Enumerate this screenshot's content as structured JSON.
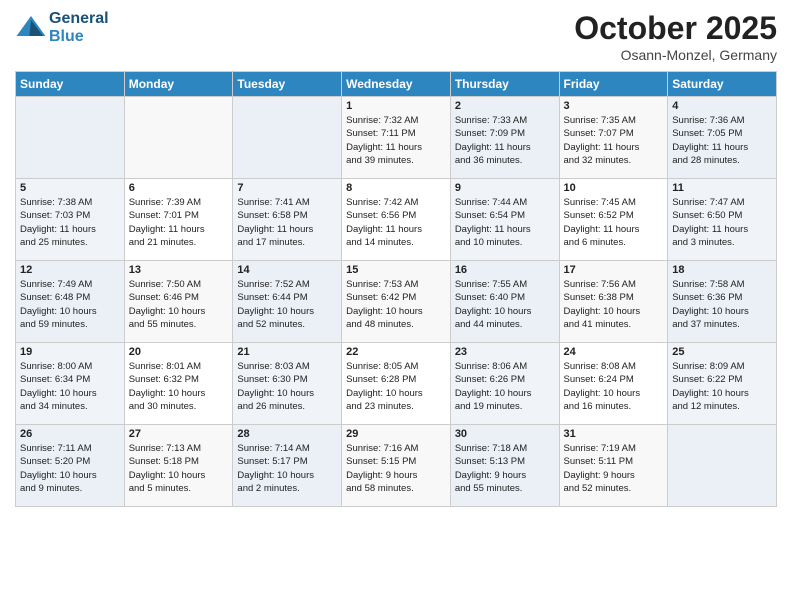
{
  "header": {
    "logo_line1": "General",
    "logo_line2": "Blue",
    "month": "October 2025",
    "location": "Osann-Monzel, Germany"
  },
  "days_of_week": [
    "Sunday",
    "Monday",
    "Tuesday",
    "Wednesday",
    "Thursday",
    "Friday",
    "Saturday"
  ],
  "weeks": [
    [
      {
        "day": "",
        "info": ""
      },
      {
        "day": "",
        "info": ""
      },
      {
        "day": "",
        "info": ""
      },
      {
        "day": "1",
        "info": "Sunrise: 7:32 AM\nSunset: 7:11 PM\nDaylight: 11 hours\nand 39 minutes."
      },
      {
        "day": "2",
        "info": "Sunrise: 7:33 AM\nSunset: 7:09 PM\nDaylight: 11 hours\nand 36 minutes."
      },
      {
        "day": "3",
        "info": "Sunrise: 7:35 AM\nSunset: 7:07 PM\nDaylight: 11 hours\nand 32 minutes."
      },
      {
        "day": "4",
        "info": "Sunrise: 7:36 AM\nSunset: 7:05 PM\nDaylight: 11 hours\nand 28 minutes."
      }
    ],
    [
      {
        "day": "5",
        "info": "Sunrise: 7:38 AM\nSunset: 7:03 PM\nDaylight: 11 hours\nand 25 minutes."
      },
      {
        "day": "6",
        "info": "Sunrise: 7:39 AM\nSunset: 7:01 PM\nDaylight: 11 hours\nand 21 minutes."
      },
      {
        "day": "7",
        "info": "Sunrise: 7:41 AM\nSunset: 6:58 PM\nDaylight: 11 hours\nand 17 minutes."
      },
      {
        "day": "8",
        "info": "Sunrise: 7:42 AM\nSunset: 6:56 PM\nDaylight: 11 hours\nand 14 minutes."
      },
      {
        "day": "9",
        "info": "Sunrise: 7:44 AM\nSunset: 6:54 PM\nDaylight: 11 hours\nand 10 minutes."
      },
      {
        "day": "10",
        "info": "Sunrise: 7:45 AM\nSunset: 6:52 PM\nDaylight: 11 hours\nand 6 minutes."
      },
      {
        "day": "11",
        "info": "Sunrise: 7:47 AM\nSunset: 6:50 PM\nDaylight: 11 hours\nand 3 minutes."
      }
    ],
    [
      {
        "day": "12",
        "info": "Sunrise: 7:49 AM\nSunset: 6:48 PM\nDaylight: 10 hours\nand 59 minutes."
      },
      {
        "day": "13",
        "info": "Sunrise: 7:50 AM\nSunset: 6:46 PM\nDaylight: 10 hours\nand 55 minutes."
      },
      {
        "day": "14",
        "info": "Sunrise: 7:52 AM\nSunset: 6:44 PM\nDaylight: 10 hours\nand 52 minutes."
      },
      {
        "day": "15",
        "info": "Sunrise: 7:53 AM\nSunset: 6:42 PM\nDaylight: 10 hours\nand 48 minutes."
      },
      {
        "day": "16",
        "info": "Sunrise: 7:55 AM\nSunset: 6:40 PM\nDaylight: 10 hours\nand 44 minutes."
      },
      {
        "day": "17",
        "info": "Sunrise: 7:56 AM\nSunset: 6:38 PM\nDaylight: 10 hours\nand 41 minutes."
      },
      {
        "day": "18",
        "info": "Sunrise: 7:58 AM\nSunset: 6:36 PM\nDaylight: 10 hours\nand 37 minutes."
      }
    ],
    [
      {
        "day": "19",
        "info": "Sunrise: 8:00 AM\nSunset: 6:34 PM\nDaylight: 10 hours\nand 34 minutes."
      },
      {
        "day": "20",
        "info": "Sunrise: 8:01 AM\nSunset: 6:32 PM\nDaylight: 10 hours\nand 30 minutes."
      },
      {
        "day": "21",
        "info": "Sunrise: 8:03 AM\nSunset: 6:30 PM\nDaylight: 10 hours\nand 26 minutes."
      },
      {
        "day": "22",
        "info": "Sunrise: 8:05 AM\nSunset: 6:28 PM\nDaylight: 10 hours\nand 23 minutes."
      },
      {
        "day": "23",
        "info": "Sunrise: 8:06 AM\nSunset: 6:26 PM\nDaylight: 10 hours\nand 19 minutes."
      },
      {
        "day": "24",
        "info": "Sunrise: 8:08 AM\nSunset: 6:24 PM\nDaylight: 10 hours\nand 16 minutes."
      },
      {
        "day": "25",
        "info": "Sunrise: 8:09 AM\nSunset: 6:22 PM\nDaylight: 10 hours\nand 12 minutes."
      }
    ],
    [
      {
        "day": "26",
        "info": "Sunrise: 7:11 AM\nSunset: 5:20 PM\nDaylight: 10 hours\nand 9 minutes."
      },
      {
        "day": "27",
        "info": "Sunrise: 7:13 AM\nSunset: 5:18 PM\nDaylight: 10 hours\nand 5 minutes."
      },
      {
        "day": "28",
        "info": "Sunrise: 7:14 AM\nSunset: 5:17 PM\nDaylight: 10 hours\nand 2 minutes."
      },
      {
        "day": "29",
        "info": "Sunrise: 7:16 AM\nSunset: 5:15 PM\nDaylight: 9 hours\nand 58 minutes."
      },
      {
        "day": "30",
        "info": "Sunrise: 7:18 AM\nSunset: 5:13 PM\nDaylight: 9 hours\nand 55 minutes."
      },
      {
        "day": "31",
        "info": "Sunrise: 7:19 AM\nSunset: 5:11 PM\nDaylight: 9 hours\nand 52 minutes."
      },
      {
        "day": "",
        "info": ""
      }
    ]
  ]
}
